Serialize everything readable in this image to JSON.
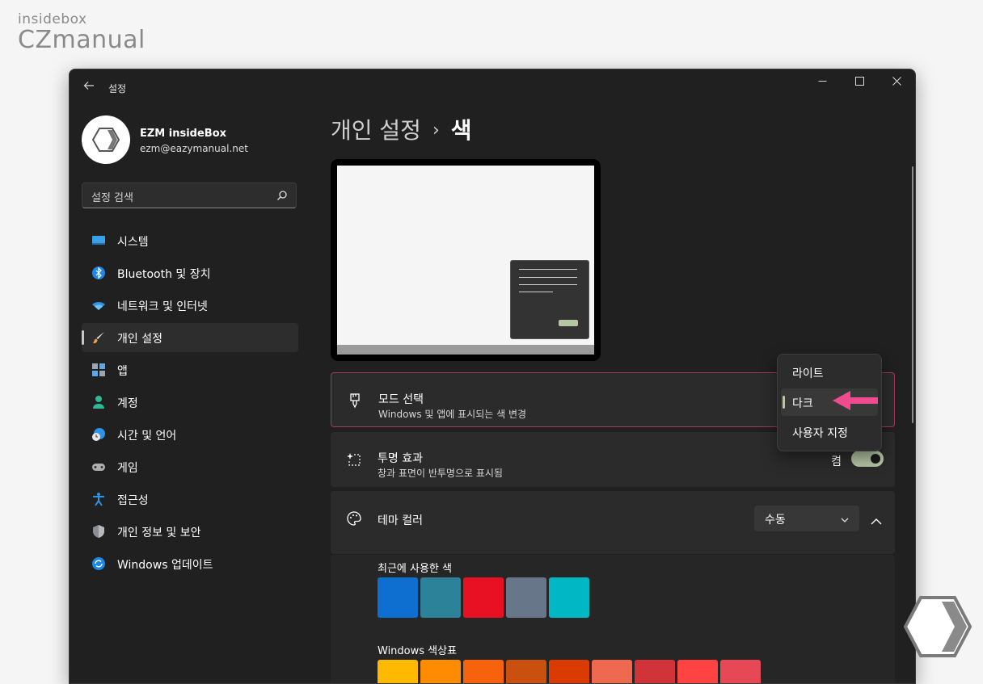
{
  "watermark": {
    "line1": "insidebox",
    "line2": "CZmanual"
  },
  "window": {
    "title": "설정",
    "controls": [
      "minimize",
      "maximize",
      "close"
    ]
  },
  "profile": {
    "name": "EZM insideBox",
    "email": "ezm@eazymanual.net"
  },
  "search": {
    "placeholder": "설정 검색"
  },
  "sidebar": {
    "items": [
      {
        "label": "시스템",
        "icon": "monitor-icon",
        "active": false
      },
      {
        "label": "Bluetooth 및 장치",
        "icon": "bluetooth-icon",
        "active": false
      },
      {
        "label": "네트워크 및 인터넷",
        "icon": "wifi-icon",
        "active": false
      },
      {
        "label": "개인 설정",
        "icon": "brush-icon",
        "active": true
      },
      {
        "label": "앱",
        "icon": "apps-icon",
        "active": false
      },
      {
        "label": "계정",
        "icon": "person-icon",
        "active": false
      },
      {
        "label": "시간 및 언어",
        "icon": "globe-clock-icon",
        "active": false
      },
      {
        "label": "게임",
        "icon": "gamepad-icon",
        "active": false
      },
      {
        "label": "접근성",
        "icon": "accessibility-icon",
        "active": false
      },
      {
        "label": "개인 정보 및 보안",
        "icon": "shield-icon",
        "active": false
      },
      {
        "label": "Windows 업데이트",
        "icon": "update-icon",
        "active": false
      }
    ]
  },
  "breadcrumb": {
    "parent": "개인 설정",
    "separator": "›",
    "current": "색"
  },
  "mode": {
    "title": "모드 선택",
    "subtitle": "Windows 및 앱에 표시되는 색 변경"
  },
  "mode_menu": {
    "options": [
      "라이트",
      "다크",
      "사용자 지정"
    ],
    "selected_index": 1
  },
  "transparency": {
    "title": "투명 효과",
    "subtitle": "창과 표면이 반투명으로 표시됨",
    "state_label": "켬",
    "on": true
  },
  "theme_color": {
    "title": "테마 컬러",
    "value": "수동",
    "recent_label": "최근에 사용한 색",
    "palette_label": "Windows 색상표"
  },
  "colors": {
    "recent": [
      "#0f6fd1",
      "#2b8299",
      "#e81123",
      "#68768a",
      "#00b7c3"
    ],
    "palette": [
      "#ffb900",
      "#ff8c00",
      "#f7630c",
      "#ca5010",
      "#da3b01",
      "#ef6950",
      "#d13438",
      "#ff4343",
      "#e74856"
    ],
    "accent_pink": "#f04b8f",
    "toggle_on": "#b7c7a6"
  }
}
